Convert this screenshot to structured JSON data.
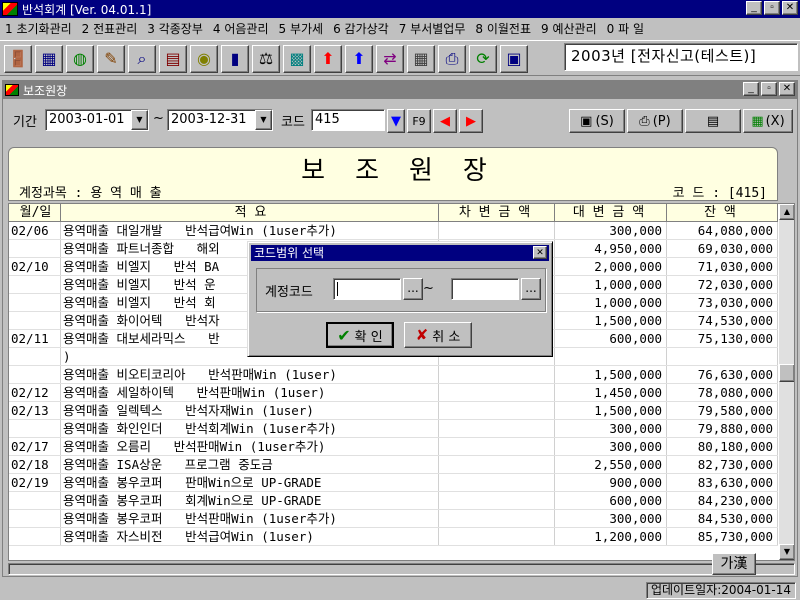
{
  "window": {
    "title": "반석회계 [Ver. 04.01.1]",
    "controls": {
      "minimize": "_",
      "maximize": "▫",
      "close": "✕"
    }
  },
  "menu": [
    {
      "label": "1 초기화관리"
    },
    {
      "label": "2 전표관리"
    },
    {
      "label": "3 각종장부"
    },
    {
      "label": "4 어음관리"
    },
    {
      "label": "5 부가세"
    },
    {
      "label": "6 감가상각"
    },
    {
      "label": "7 부서별업무"
    },
    {
      "label": "8 이월전표"
    },
    {
      "label": "9 예산관리"
    },
    {
      "label": "0 파 일"
    }
  ],
  "toolbar": {
    "buttons": [
      {
        "icon": "exit-door-icon",
        "glyph": "🚪",
        "color": "#800000"
      },
      {
        "icon": "org-chart-icon",
        "glyph": "▦",
        "color": "#000080"
      },
      {
        "icon": "globe-icon",
        "glyph": "◍",
        "color": "#008000"
      },
      {
        "icon": "pencil-ruler-icon",
        "glyph": "✎",
        "color": "#804000"
      },
      {
        "icon": "magnifier-icon",
        "glyph": "⌕",
        "color": "#000080"
      },
      {
        "icon": "abacus-icon",
        "glyph": "▤",
        "color": "#800000"
      },
      {
        "icon": "coin-icon",
        "glyph": "◉",
        "color": "#808000"
      },
      {
        "icon": "book-icon",
        "glyph": "▮",
        "color": "#000080"
      },
      {
        "icon": "scale-icon",
        "glyph": "⚖",
        "color": "#000000"
      },
      {
        "icon": "chart-grid-icon",
        "glyph": "▩",
        "color": "#008080"
      },
      {
        "icon": "arrow-up-red-icon",
        "glyph": "⬆",
        "color": "#ff0000"
      },
      {
        "icon": "arrow-up-blue-icon",
        "glyph": "⬆",
        "color": "#0000ff"
      },
      {
        "icon": "transfer-icon",
        "glyph": "⇄",
        "color": "#800080"
      },
      {
        "icon": "calculator-icon",
        "glyph": "▦",
        "color": "#404040"
      },
      {
        "icon": "printer-icon",
        "glyph": "⎙",
        "color": "#000080"
      },
      {
        "icon": "refresh-icon",
        "glyph": "⟳",
        "color": "#008000"
      },
      {
        "icon": "calendar-icon",
        "glyph": "▣",
        "color": "#000080"
      }
    ],
    "company": "2003년 [전자신고(테스트)]"
  },
  "child": {
    "title": "보조원장",
    "controls": {
      "minimize": "_",
      "maximize": "▫",
      "close": "✕"
    }
  },
  "filter": {
    "period_label": "기간",
    "date_from": "2003-01-01",
    "tilde": "~",
    "date_to": "2003-12-31",
    "code_label": "코드",
    "code_value": "415",
    "f9_label": "F9",
    "save_label": "(S)",
    "print_label": "(P)",
    "exit_label": "(X)"
  },
  "report": {
    "title": "보조원장",
    "account": "계정과목 : 용 역 매 출",
    "code": "코 드 : [415]"
  },
  "grid": {
    "headers": {
      "date": "월/일",
      "desc": "적                   요",
      "debit": "차 변 금 액",
      "credit": "대 변 금 액",
      "balance": "잔    액"
    },
    "rows": [
      {
        "date": "02/06",
        "desc": "용역매출 대일개발   반석급여Win (1user추가)",
        "debit": "",
        "credit": "300,000",
        "balance": "64,080,000"
      },
      {
        "date": "",
        "desc": "용역매출 파트너종합   해외",
        "debit": "",
        "credit": "4,950,000",
        "balance": "69,030,000"
      },
      {
        "date": "02/10",
        "desc": "용역매출 비엘지   반석 BA",
        "debit": "",
        "credit": "2,000,000",
        "balance": "71,030,000"
      },
      {
        "date": "",
        "desc": "용역매출 비엘지   반석 운",
        "debit": "",
        "credit": "1,000,000",
        "balance": "72,030,000"
      },
      {
        "date": "",
        "desc": "용역매출 비엘지   반석 회",
        "debit": "",
        "credit": "1,000,000",
        "balance": "73,030,000"
      },
      {
        "date": "",
        "desc": "용역매출 화이어텍   반석자",
        "debit": "",
        "credit": "1,500,000",
        "balance": "74,530,000"
      },
      {
        "date": "02/11",
        "desc": "용역매출 대보세라믹스   반",
        "debit": "",
        "credit": "600,000",
        "balance": "75,130,000"
      },
      {
        "date": "",
        "desc": ")",
        "debit": "",
        "credit": "",
        "balance": ""
      },
      {
        "date": "",
        "desc": "용역매출 비오티코리아   반석판매Win (1user)",
        "debit": "",
        "credit": "1,500,000",
        "balance": "76,630,000"
      },
      {
        "date": "02/12",
        "desc": "용역매출 세일하이텍   반석판매Win (1user)",
        "debit": "",
        "credit": "1,450,000",
        "balance": "78,080,000"
      },
      {
        "date": "02/13",
        "desc": "용역매출 일렉텍스   반석자재Win (1user)",
        "debit": "",
        "credit": "1,500,000",
        "balance": "79,580,000"
      },
      {
        "date": "",
        "desc": "용역매출 화인인더   반석회계Win (1user추가)",
        "debit": "",
        "credit": "300,000",
        "balance": "79,880,000"
      },
      {
        "date": "02/17",
        "desc": "용역매출 오름리   반석판매Win (1user추가)",
        "debit": "",
        "credit": "300,000",
        "balance": "80,180,000"
      },
      {
        "date": "02/18",
        "desc": "용역매출 ISA상운   프로그램 중도금",
        "debit": "",
        "credit": "2,550,000",
        "balance": "82,730,000"
      },
      {
        "date": "02/19",
        "desc": "용역매출 봉우코퍼   판매Win으로 UP-GRADE",
        "debit": "",
        "credit": "900,000",
        "balance": "83,630,000"
      },
      {
        "date": "",
        "desc": "용역매출 봉우코퍼   회계Win으로 UP-GRADE",
        "debit": "",
        "credit": "600,000",
        "balance": "84,230,000"
      },
      {
        "date": "",
        "desc": "용역매출 봉우코퍼   반석판매Win (1user추가)",
        "debit": "",
        "credit": "300,000",
        "balance": "84,530,000"
      },
      {
        "date": "",
        "desc": "용역매출 자스비전   반석급여Win (1user)",
        "debit": "",
        "credit": "1,200,000",
        "balance": "85,730,000"
      }
    ]
  },
  "dialog": {
    "title": "코드범위 선택",
    "code_label": "계정코드",
    "from_value": "",
    "to_value": "",
    "browse": "...",
    "tilde": "~",
    "ok_label": "확 인",
    "cancel_label": "취 소"
  },
  "ime": "가漢",
  "status": {
    "update": "업데이트일자:2004-01-14"
  },
  "colors": {
    "titlebar": "#000080",
    "report_bg": "#ffffe1",
    "face": "#c0c0c0"
  }
}
